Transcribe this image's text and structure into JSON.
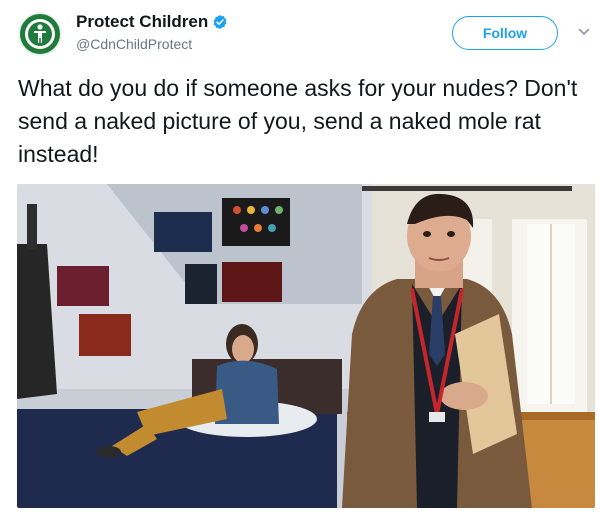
{
  "tweet": {
    "display_name": "Protect Children",
    "handle": "@CdnChildProtect",
    "follow_label": "Follow",
    "text": "What do you do if someone asks for your nudes? Don't send a naked picture of you, send a naked mole rat instead!",
    "media_icon": "video-still",
    "verified_icon": "verified-badge-icon",
    "caret_icon": "chevron-down-icon"
  },
  "colors": {
    "accent": "#1da1f2",
    "avatar_bg": "#1f7a3c",
    "text": "#14171a",
    "secondary_text": "#657786"
  }
}
